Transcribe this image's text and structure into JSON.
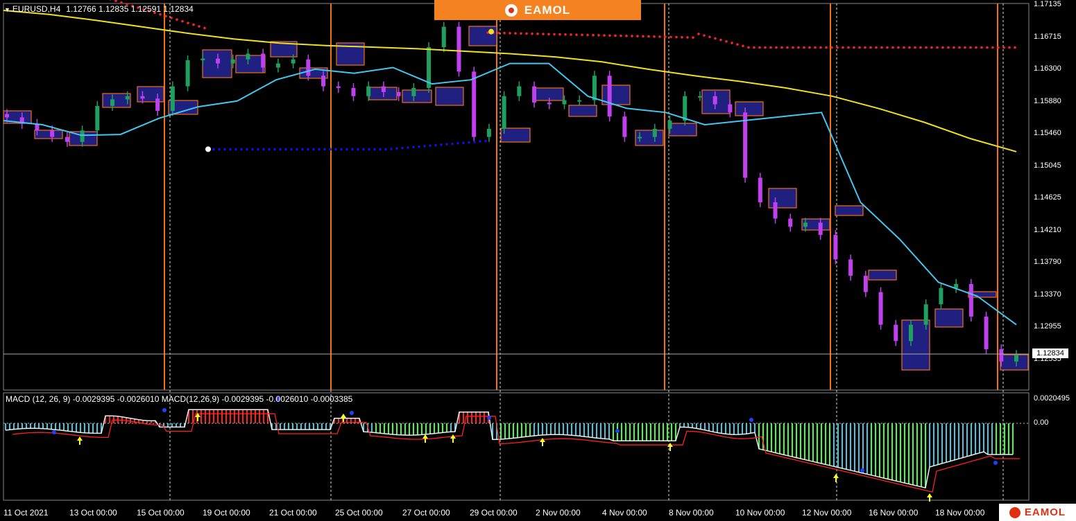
{
  "header": {
    "symbol": "EURUSD,H4",
    "ohlc": "1.12766 1.12835 1.12591 1.12834"
  },
  "macd_header": "MACD (12, 26, 9)  -0.0029395 -0.0026010  MACD(12,26,9) -0.0029395 -0.0026010 -0.0003385",
  "logo_text": "EAMOL",
  "current_price_tag": "1.12834",
  "price_axis": [
    "1.17135",
    "1.16715",
    "1.16300",
    "1.15880",
    "1.15460",
    "1.15045",
    "1.14625",
    "1.14210",
    "1.13790",
    "1.13370",
    "1.12955",
    "1.12535"
  ],
  "macd_axis": [
    "0.0020495",
    "0.00"
  ],
  "time_axis": [
    "11 Oct 2021",
    "13 Oct 00:00",
    "15 Oct 00:00",
    "19 Oct 00:00",
    "21 Oct 00:00",
    "25 Oct 00:00",
    "27 Oct 00:00",
    "29 Oct 00:00",
    "2 Nov 00:00",
    "4 Nov 00:00",
    "8 Nov 00:00",
    "10 Nov 00:00",
    "12 Nov 00:00",
    "16 Nov 00:00",
    "18 Nov 00:00"
  ],
  "colors": {
    "bull": "#1fa060",
    "bear": "#c040f0",
    "ma_slow": "#f0e020",
    "ma_fast": "#40c8f0",
    "sar_top": "#ff2020",
    "sar_bottom": "#1010e0",
    "orange": "#f57010",
    "box_fill": "#202080",
    "macd_green": "#40ff40",
    "macd_blue": "#40c8e0",
    "macd_red": "#ff2020"
  },
  "chart_data": {
    "type": "candlestick",
    "instrument": "EURUSD",
    "timeframe": "H4",
    "ylim": [
      1.124,
      1.17135
    ],
    "moving_average_slow": [
      1.1705,
      1.17,
      1.1693,
      1.1685,
      1.1677,
      1.167,
      1.1665,
      1.1662,
      1.166,
      1.1658,
      1.1655,
      1.1652,
      1.1648,
      1.1642,
      1.1633,
      1.1625,
      1.1618,
      1.161,
      1.16,
      1.1585,
      1.1568,
      1.1548,
      1.1532
    ],
    "moving_average_fast": [
      1.157,
      1.1565,
      1.1552,
      1.1553,
      1.1573,
      1.1587,
      1.1594,
      1.162,
      1.1633,
      1.1628,
      1.1635,
      1.1615,
      1.162,
      1.164,
      1.164,
      1.16,
      1.1585,
      1.158,
      1.1565,
      1.157,
      1.1575,
      1.158,
      1.147,
      1.1425,
      1.1372,
      1.1355,
      1.132
    ],
    "closes": [
      1.1574,
      1.1566,
      1.1558,
      1.155,
      1.1544,
      1.1558,
      1.1588,
      1.1596,
      1.16,
      1.1597,
      1.1582,
      1.1612,
      1.1644,
      1.1646,
      1.164,
      1.1645,
      1.1652,
      1.1635,
      1.164,
      1.1645,
      1.1625,
      1.1612,
      1.161,
      1.16,
      1.1612,
      1.1605,
      1.16,
      1.161,
      1.166,
      1.1685,
      1.163,
      1.155,
      1.156,
      1.16,
      1.1612,
      1.1592,
      1.159,
      1.1595,
      1.1595,
      1.1625,
      1.1575,
      1.155,
      1.155,
      1.156,
      1.157,
      1.16,
      1.16,
      1.159,
      1.158,
      1.15,
      1.147,
      1.145,
      1.144,
      1.1445,
      1.143,
      1.14,
      1.138,
      1.136,
      1.132,
      1.13,
      1.132,
      1.1345,
      1.1365,
      1.137,
      1.133,
      1.129,
      1.1275,
      1.1283
    ]
  }
}
